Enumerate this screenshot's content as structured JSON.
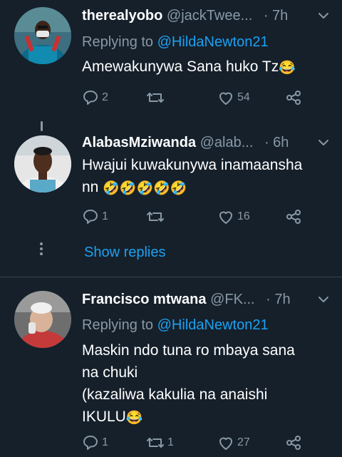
{
  "colors": {
    "background": "#15202b",
    "text": "#ffffff",
    "secondary": "#8899a6",
    "accent": "#1da1f2",
    "divider": "#38444d"
  },
  "icons": [
    "reply-icon",
    "retweet-icon",
    "like-icon",
    "share-icon",
    "chevron-down-icon"
  ],
  "tweets": [
    {
      "name": "therealyobo",
      "handle": "@jackTwee...",
      "time": "· 7h",
      "replying_label": "Replying to",
      "replying_to": "@HildaNewton21",
      "text": "Amewakunywa Sana huko Tz",
      "emoji": "😂",
      "replies": "2",
      "retweets": "",
      "likes": "54"
    },
    {
      "name": "AlabasMziwanda",
      "handle": "@alab...",
      "time": "· 6h",
      "text_line1": "Hwajui kuwakunywa inamaansha",
      "text_line2": "nn",
      "emoji": "🤣🤣🤣🤣🤣",
      "replies": "1",
      "retweets": "",
      "likes": "16"
    },
    {
      "name": "Francisco mtwana",
      "handle": "@FK...",
      "time": "· 7h",
      "replying_label": "Replying to",
      "replying_to": "@HildaNewton21",
      "text_line1": "Maskin ndo tuna ro mbaya sana",
      "text_line2": "na chuki",
      "text_line3": "(kazaliwa kakulia na anaishi",
      "text_line4": "IKULU",
      "emoji": "😂",
      "replies": "1",
      "retweets": "1",
      "likes": "27"
    }
  ],
  "show_replies": "Show replies"
}
